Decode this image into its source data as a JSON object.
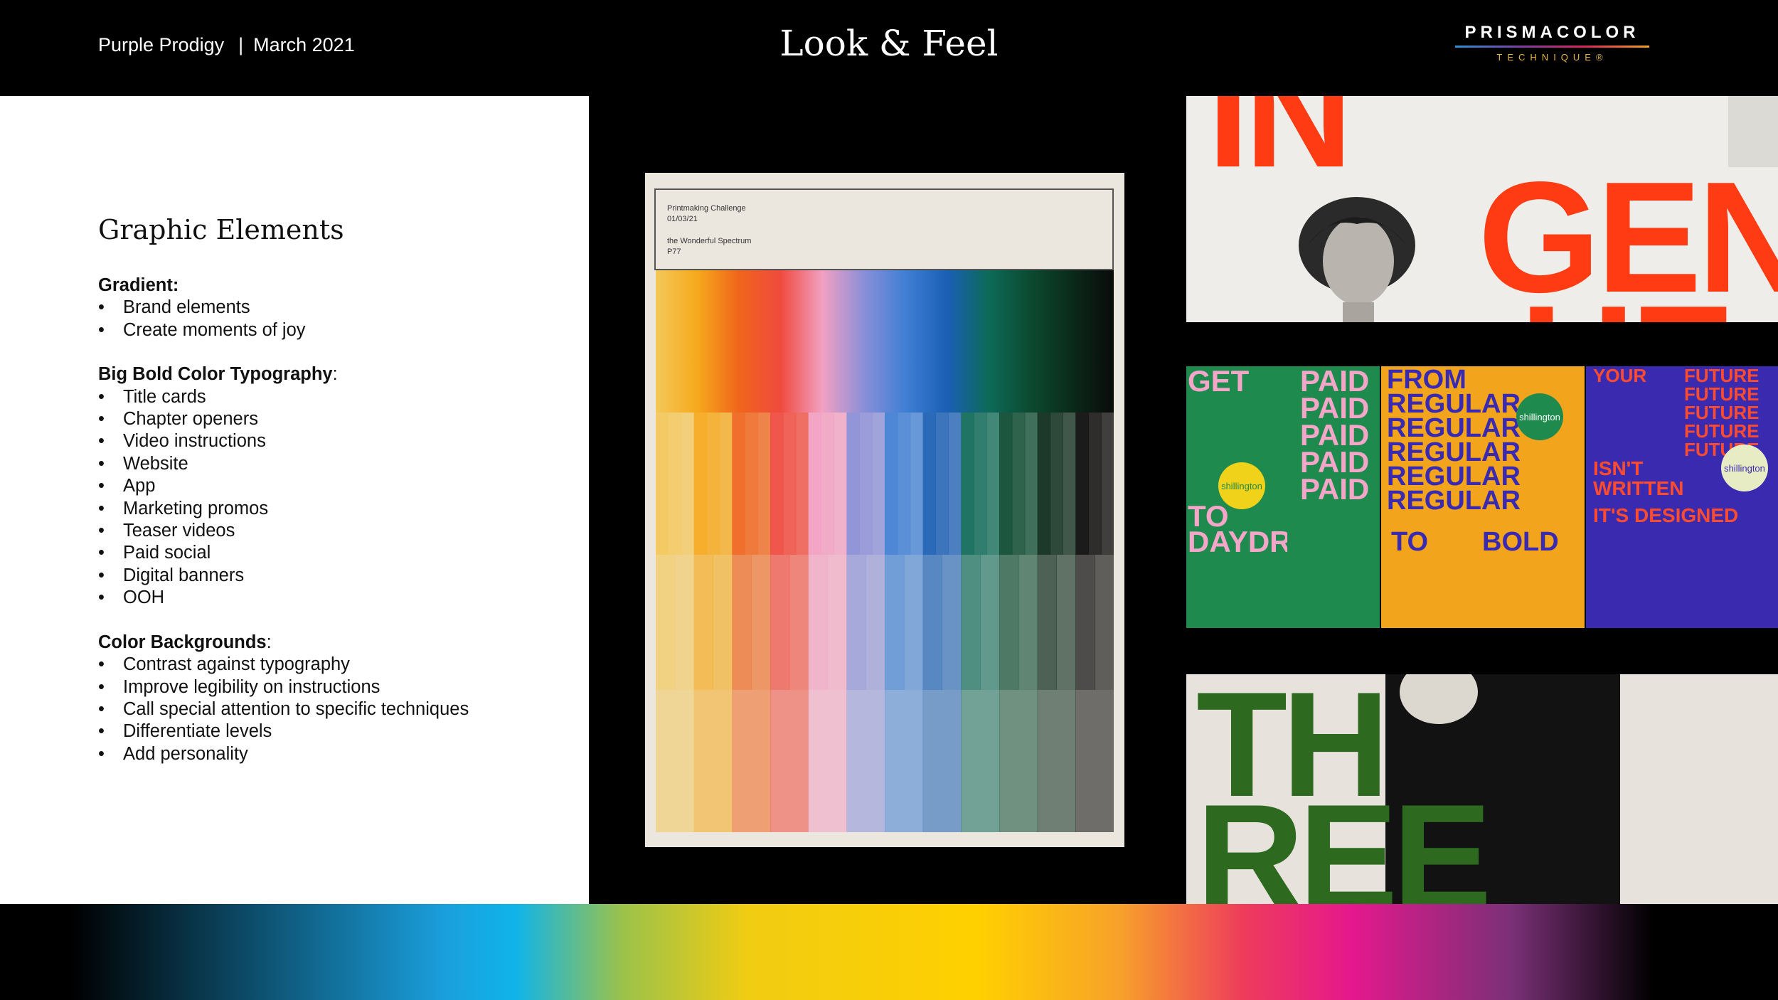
{
  "header": {
    "project": "Purple Prodigy",
    "separator": "|",
    "date": "March 2021",
    "title": "Look & Feel",
    "logo": {
      "name": "PRISMACOLOR",
      "sub": "TECHNIQUE®"
    }
  },
  "left": {
    "section_title": "Graphic Elements",
    "groups": [
      {
        "heading": "Gradient",
        "colon": ":",
        "items": [
          "Brand elements",
          "Create moments of joy"
        ]
      },
      {
        "heading": "Big Bold Color Typography",
        "colon": ":",
        "items": [
          "Title cards",
          "Chapter openers",
          "Video instructions",
          "Website",
          "App",
          "Marketing promos",
          "Teaser videos",
          "Paid social",
          "Digital banners",
          "OOH"
        ]
      },
      {
        "heading": "Color Backgrounds",
        "colon": ":",
        "items": [
          "Contrast against typography",
          "Improve legibility on instructions",
          "Call special attention to specific techniques",
          "Differentiate levels",
          "Add personality"
        ]
      }
    ]
  },
  "poster": {
    "line1": "Printmaking Challenge",
    "line2": "01/03/21",
    "line3": "the Wonderful Spectrum",
    "line4": "P77",
    "colors": [
      "#f4c85a",
      "#f6a91c",
      "#f0651c",
      "#f04a3e",
      "#f2a0c2",
      "#8a8fd8",
      "#3f7fd4",
      "#1a5fb5",
      "#0d6a58",
      "#0b4a30",
      "#0a2a1a",
      "#0a0a0a"
    ]
  },
  "moodboard": {
    "image1": {
      "word1": "IN",
      "word2": "GEN",
      "word3": "UE"
    },
    "image2": {
      "col1": {
        "lines": [
          "GET",
          "TO",
          "DAYDREAM"
        ],
        "badge": "shillington",
        "bg": "#1f8a4e",
        "fg": "#f3a6c8"
      },
      "col2": {
        "lines": [
          "PAID",
          "PAID",
          "PAID",
          "PAID",
          "PAID"
        ],
        "bg": "#1f8a4e",
        "fg": "#f3a6c8"
      },
      "col3": {
        "lines": [
          "FROM",
          "REGULAR",
          "REGULAR",
          "REGULAR",
          "REGULAR",
          "REGULAR",
          "TO",
          "BOLD"
        ],
        "badge": "shillington",
        "bg": "#f2a41c",
        "fg": "#3a2ab0"
      },
      "col4": {
        "lines": [
          "YOUR",
          "FUTURE",
          "FUTURE",
          "FUTURE",
          "FUTURE",
          "FUTURE",
          "ISN'T",
          "WRITTEN",
          "IT'S DESIGNED"
        ],
        "badge": "shillington",
        "bg": "#3a2ab0",
        "fg": "#ff4b2e"
      }
    },
    "image3": {
      "word1": "TH",
      "word2": "REE"
    }
  }
}
